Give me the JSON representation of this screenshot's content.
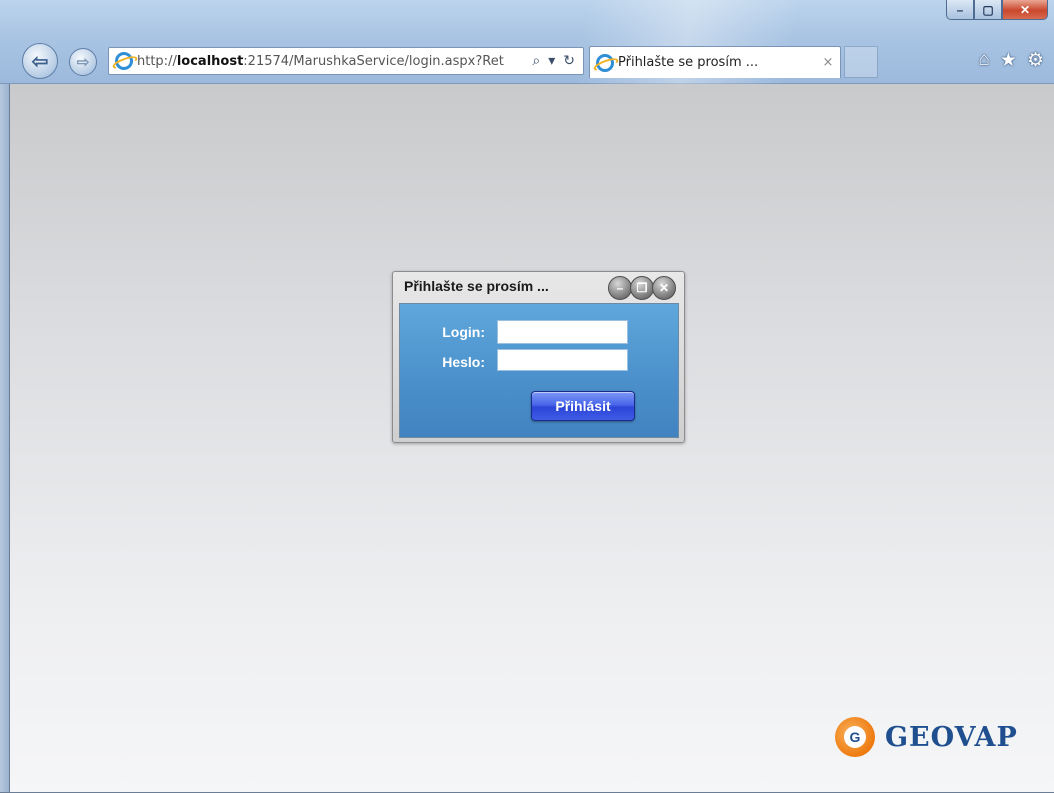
{
  "browser": {
    "url_prefix": "http://",
    "url_host": "localhost",
    "url_rest": ":21574/MarushkaService/login.aspx?Ret",
    "tab_title": "Přihlašte se prosím ...",
    "tab_close": "×",
    "window_controls": {
      "minimize": "–",
      "maximize": "▢",
      "close": "✕"
    },
    "nav": {
      "back": "⇦",
      "forward": "⇨"
    },
    "address_tools": {
      "search": "⌕",
      "dropdown": "▾",
      "refresh": "↻"
    },
    "toolbar": {
      "home": "⌂",
      "favorites": "★",
      "tools": "⚙"
    }
  },
  "dialog": {
    "title": "Přihlašte se prosím ...",
    "controls": {
      "minimize": "–",
      "restore": "❐",
      "close": "✕"
    },
    "login_label": "Login:",
    "password_label": "Heslo:",
    "login_value": "",
    "password_value": "",
    "submit_label": "Přihlásit"
  },
  "logo": {
    "mark": "G",
    "text": "GEOVAP"
  },
  "colors": {
    "dialog_body": "#4a8fca",
    "login_button": "#3f5de6",
    "logo_orange": "#ee7a10",
    "logo_blue": "#1f4f8f"
  }
}
